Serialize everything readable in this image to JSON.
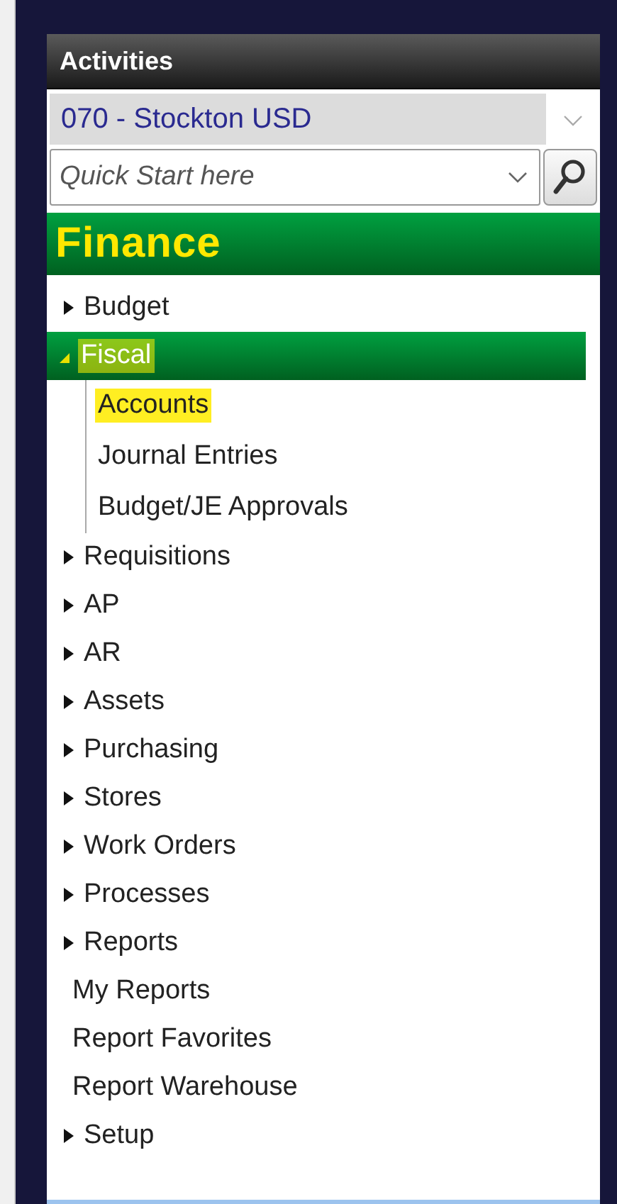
{
  "panel": {
    "title": "Activities"
  },
  "district": {
    "value": "070 - Stockton USD"
  },
  "quick_start": {
    "placeholder": "Quick Start here"
  },
  "section": {
    "title": "Finance"
  },
  "tree": [
    {
      "kind": "group",
      "label": "Budget",
      "expanded": false,
      "selected": false,
      "highlighted": false
    },
    {
      "kind": "group",
      "label": "Fiscal",
      "expanded": true,
      "selected": true,
      "highlighted": true,
      "children": [
        {
          "label": "Accounts",
          "selected": false,
          "highlighted": true
        },
        {
          "label": "Journal Entries",
          "selected": false,
          "highlighted": false
        },
        {
          "label": "Budget/JE Approvals",
          "selected": false,
          "highlighted": false
        }
      ]
    },
    {
      "kind": "group",
      "label": "Requisitions",
      "expanded": false,
      "selected": false,
      "highlighted": false
    },
    {
      "kind": "group",
      "label": "AP",
      "expanded": false,
      "selected": false,
      "highlighted": false
    },
    {
      "kind": "group",
      "label": "AR",
      "expanded": false,
      "selected": false,
      "highlighted": false
    },
    {
      "kind": "group",
      "label": "Assets",
      "expanded": false,
      "selected": false,
      "highlighted": false
    },
    {
      "kind": "group",
      "label": "Purchasing",
      "expanded": false,
      "selected": false,
      "highlighted": false
    },
    {
      "kind": "group",
      "label": "Stores",
      "expanded": false,
      "selected": false,
      "highlighted": false
    },
    {
      "kind": "group",
      "label": "Work Orders",
      "expanded": false,
      "selected": false,
      "highlighted": false
    },
    {
      "kind": "group",
      "label": "Processes",
      "expanded": false,
      "selected": false,
      "highlighted": false
    },
    {
      "kind": "group",
      "label": "Reports",
      "expanded": false,
      "selected": false,
      "highlighted": false
    },
    {
      "kind": "link",
      "label": "My Reports",
      "selected": false,
      "highlighted": false
    },
    {
      "kind": "link",
      "label": "Report Favorites",
      "selected": false,
      "highlighted": false
    },
    {
      "kind": "link",
      "label": "Report Warehouse",
      "selected": false,
      "highlighted": false
    },
    {
      "kind": "group",
      "label": "Setup",
      "expanded": false,
      "selected": false,
      "highlighted": false
    }
  ]
}
